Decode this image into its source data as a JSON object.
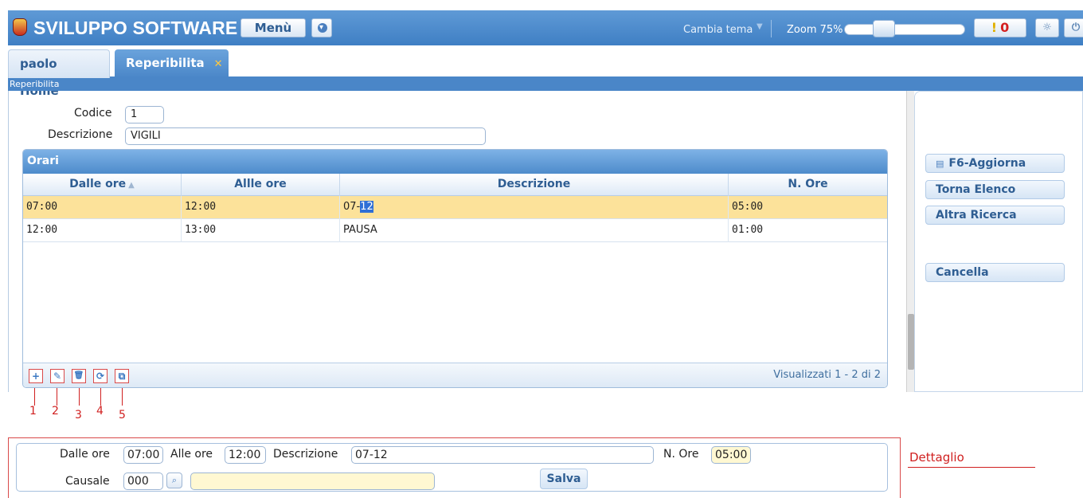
{
  "header": {
    "app_title": "SVILUPPO SOFTWARE",
    "menu_label": "Menù",
    "theme_label": "Cambia tema",
    "zoom_label": "Zoom 75%",
    "zoom_value": 0.75,
    "alert_icon": "!",
    "alert_count": "0",
    "gear_icon": "☼",
    "power_icon": "⏻",
    "brand_color": "#4a86c8"
  },
  "tabs": [
    {
      "label": "paolo Home",
      "active": false
    },
    {
      "label": "Reperibilita",
      "active": true,
      "close_icon": "✕"
    }
  ],
  "breadcrumb": "Reperibilita",
  "form": {
    "codice_label": "Codice",
    "codice_value": "1",
    "descrizione_label": "Descrizione",
    "descrizione_value": "VIGILI"
  },
  "grid": {
    "title": "Orari",
    "columns": [
      "Dalle ore",
      "Allle ore",
      "Descrizione",
      "N. Ore"
    ],
    "sort_icon": "▲",
    "rows": [
      {
        "dalle": "07:00",
        "alle": "12:00",
        "desc_prefix": "07-",
        "desc_highlight": "12",
        "nore": "05:00",
        "selected": true
      },
      {
        "dalle": "12:00",
        "alle": "13:00",
        "desc_prefix": "PAUSA",
        "desc_highlight": "",
        "nore": "01:00",
        "selected": false
      }
    ],
    "toolbar_icons": [
      "+",
      "✎",
      "🗑",
      "⟳",
      "⧉"
    ],
    "footer_text": "Visualizzati 1 - 2 di 2",
    "annotations": [
      "1",
      "2",
      "3",
      "4",
      "5"
    ]
  },
  "actions": {
    "aggiorna": "F6-Aggiorna",
    "aggiorna_icon": "▤",
    "torna": "Torna Elenco",
    "ricerca": "Altra Ricerca",
    "cancella": "Cancella"
  },
  "detail": {
    "section_label": "Dettaglio",
    "dalle_label": "Dalle ore",
    "dalle_value": "07:00",
    "alle_label": "Alle ore",
    "alle_value": "12:00",
    "descrizione_label": "Descrizione",
    "descrizione_value": "07-12",
    "nore_label": "N. Ore",
    "nore_value": "05:00",
    "causale_label": "Causale",
    "causale_value": "000",
    "causale_desc": "",
    "lookup_icon": "⌕",
    "save_label": "Salva"
  }
}
